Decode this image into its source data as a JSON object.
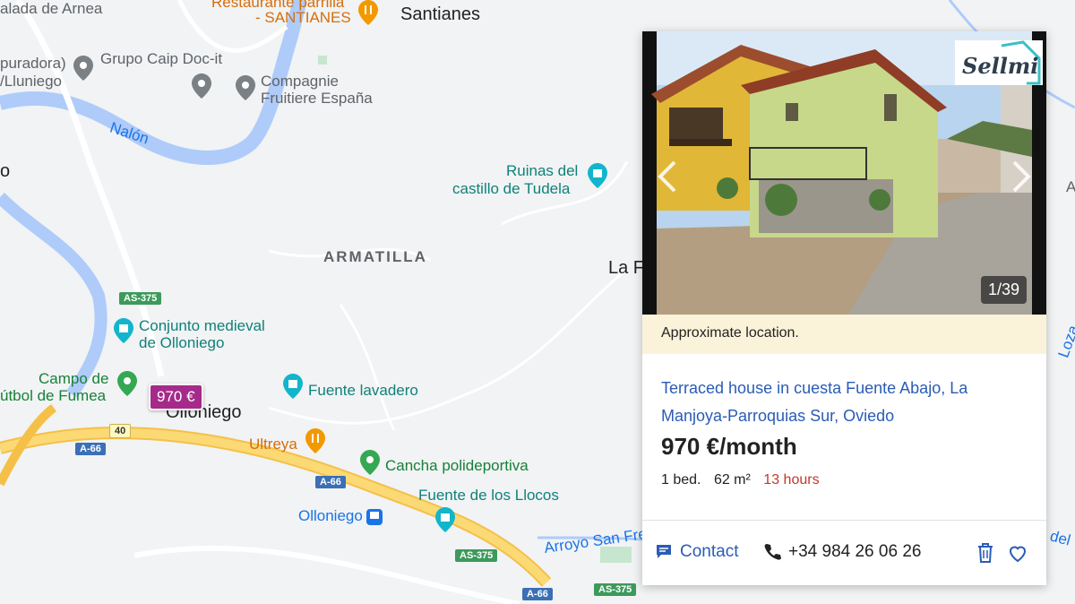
{
  "map": {
    "places": {
      "santianes": "Santianes",
      "olloniego": "Olloniego",
      "la_f": "La F",
      "armatilla": "ARMATILLA"
    },
    "pois": {
      "restaurante": "Restaurante parrilla",
      "restaurante2": "- SANTIANES",
      "aladade": "alada de Arnea",
      "depuradora": "puradora)",
      "lluniego": "/Lluniego",
      "grupo_caip": "Grupo Caip Doc-it",
      "compagnie1": "Compagnie",
      "compagnie2": "Fruitiere España",
      "ruinas1": "Ruinas del",
      "ruinas2": "castillo de Tudela",
      "conjunto1": "Conjunto medieval",
      "conjunto2": "de Olloniego",
      "campo1": "Campo de",
      "campo2": "útbol de Fumea",
      "fuente_lavadero": "Fuente lavadero",
      "ultreya": "Ultreya",
      "cancha": "Cancha polideportiva",
      "fuente_llocos": "Fuente de los Llocos",
      "olloniego_station": "Olloniego",
      "arroyo": "Arroyo San Fre",
      "nalon": "Nalón",
      "lozan": "Loza",
      "del": "del",
      "o": "o",
      "a_right": "A"
    },
    "roads": {
      "as375a": "AS-375",
      "as375b": "AS-375",
      "as375c": "AS-375",
      "a66a": "A-66",
      "a66b": "A-66",
      "a66c": "A-66",
      "r40": "40"
    },
    "price_marker": "970 €"
  },
  "card": {
    "photo_counter": "1/39",
    "logo_text": "Sellmi",
    "approx_location": "Approximate location.",
    "title": "Terraced house in cuesta Fuente Abajo, La Manjoya-Parroquias Sur, Oviedo",
    "price": "970 €/month",
    "beds": "1 bed.",
    "area": "62 m²",
    "time": "13 hours",
    "contact_label": "Contact",
    "phone": "+34 984 26 06 26"
  },
  "colors": {
    "accent_blue": "#2a5cb5",
    "price_marker": "#a52a8a",
    "approx_bg": "#fbf3d9",
    "time_red": "#c0392b"
  }
}
